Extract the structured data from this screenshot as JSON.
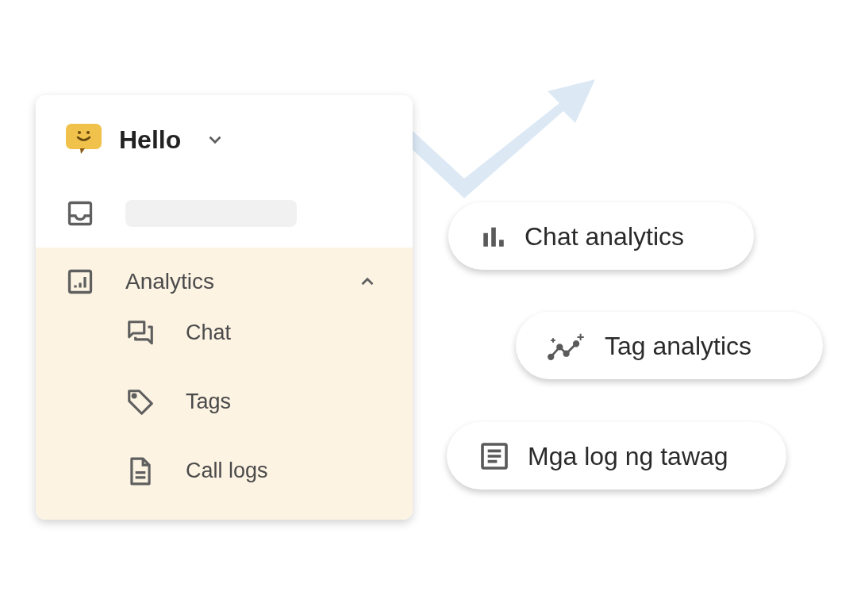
{
  "sidebar": {
    "brand": "Hello",
    "items": [
      {
        "kind": "skeleton"
      },
      {
        "kind": "group",
        "label": "Analytics",
        "expanded": true,
        "children": [
          {
            "label": "Chat"
          },
          {
            "label": "Tags"
          },
          {
            "label": "Call logs"
          }
        ]
      }
    ]
  },
  "pills": [
    {
      "label": "Chat analytics"
    },
    {
      "label": "Tag analytics"
    },
    {
      "label": "Mga log ng tawag"
    }
  ]
}
